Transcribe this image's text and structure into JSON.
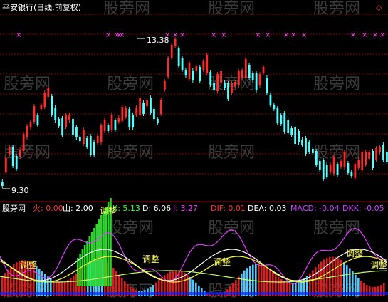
{
  "window": {
    "title": "平安银行(日线,前复权)",
    "watermark": "股旁网",
    "corner_glyph": "◇"
  },
  "price_panel": {
    "high_label": "13.38",
    "low_label": "9.30",
    "high_price": 13.38,
    "low_price": 9.3,
    "candle_up_color": "#ff2a2a",
    "candle_down_color": "#54ffff",
    "marker_color": "#ff44ff",
    "marker_glyph": "×",
    "grid_color": "#a00000"
  },
  "indicator_bar": {
    "name": "股旁网",
    "items": [
      {
        "label": "火: ",
        "value": "0.00",
        "color": "#ff3333"
      },
      {
        "label": "山: ",
        "value": "2.00",
        "color": "#ffffff"
      },
      {
        "label": "K: ",
        "value": "5.13",
        "color": "#33ff33"
      },
      {
        "label": "D: ",
        "value": "6.06",
        "color": "#ffffff"
      },
      {
        "label": "J: ",
        "value": "3.27",
        "color": "#ff44ff"
      },
      {
        "label": "DIF: ",
        "value": "0.01",
        "color": "#ff3333"
      },
      {
        "label": "DEA: ",
        "value": "0.03",
        "color": "#ffffff"
      },
      {
        "label": "MACD: ",
        "value": "-0.04",
        "color": "#cc44ff"
      },
      {
        "label": "DKK: ",
        "value": "-0.05",
        "color": "#cc44ff"
      }
    ]
  },
  "signals": {
    "adjust_label": "调整",
    "count": 6
  },
  "chart_data": {
    "type": "candlestick",
    "title": "平安银行(日线,前复权)",
    "price_annotations": {
      "high": 13.38,
      "low": 9.3
    },
    "indicators": {
      "火": 0.0,
      "山": 2.0,
      "K": 5.13,
      "D": 6.06,
      "J": 3.27,
      "DIF": 0.01,
      "DEA": 0.03,
      "MACD": -0.04,
      "DKK": -0.05
    }
  }
}
